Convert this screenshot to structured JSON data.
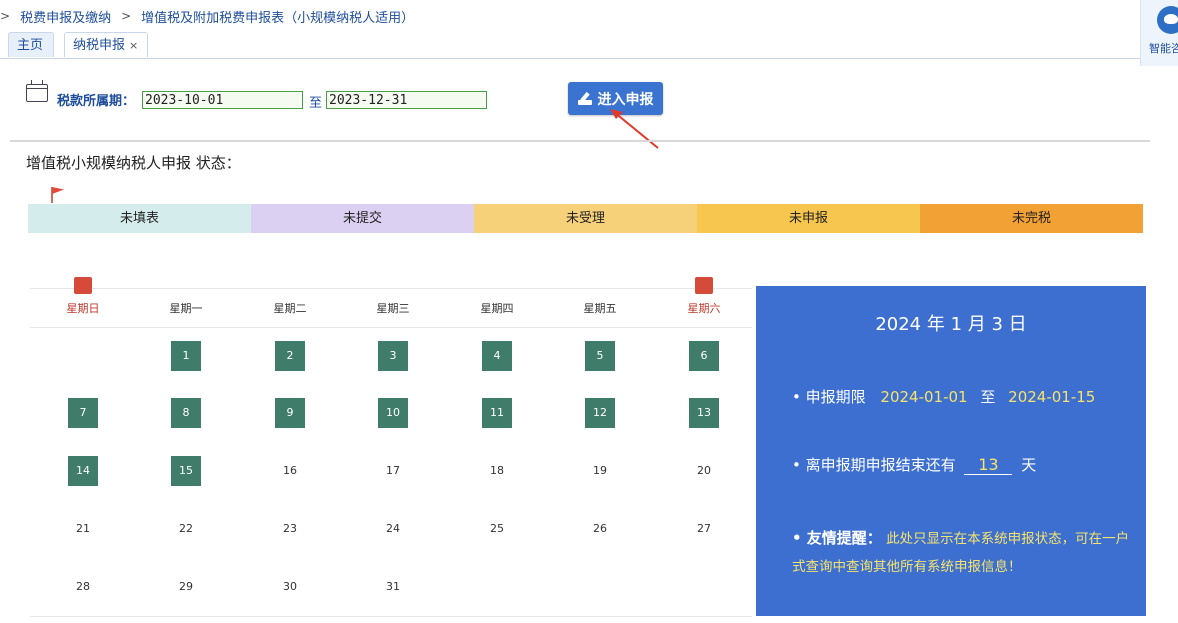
{
  "breadcrumb": {
    "items": [
      "税费申报及缴纳",
      "增值税及附加税费申报表（小规模纳税人适用）"
    ]
  },
  "tabs": [
    {
      "label": "主页"
    },
    {
      "label": "纳税申报",
      "close": "×"
    }
  ],
  "assistant": {
    "label": "智能咨"
  },
  "period": {
    "label": "税款所属期：",
    "start": "2023-10-01",
    "to": "至",
    "end": "2023-12-31"
  },
  "enter_button": {
    "label": "进入申报"
  },
  "status": {
    "title": "增值税小规模纳税人申报 状态：",
    "legend": [
      {
        "label": "未填表",
        "color": "#d5ecec"
      },
      {
        "label": "未提交",
        "color": "#dcd0f2"
      },
      {
        "label": "未受理",
        "color": "#f7d07a"
      },
      {
        "label": "未申报",
        "color": "#f7c64e"
      },
      {
        "label": "未完税",
        "color": "#f2a135"
      }
    ]
  },
  "calendar": {
    "weekdays": [
      "星期日",
      "星期一",
      "星期二",
      "星期三",
      "星期四",
      "星期五",
      "星期六"
    ],
    "weeks": [
      [
        "",
        "1",
        "2",
        "3",
        "4",
        "5",
        "6"
      ],
      [
        "7",
        "8",
        "9",
        "10",
        "11",
        "12",
        "13"
      ],
      [
        "14",
        "15",
        "16",
        "17",
        "18",
        "19",
        "20"
      ],
      [
        "21",
        "22",
        "23",
        "24",
        "25",
        "26",
        "27"
      ],
      [
        "28",
        "29",
        "30",
        "31",
        "",
        "",
        ""
      ]
    ],
    "filled_days": [
      "1",
      "2",
      "3",
      "4",
      "5",
      "6",
      "7",
      "8",
      "9",
      "10",
      "11",
      "12",
      "13",
      "14",
      "15"
    ]
  },
  "info": {
    "date": "2024 年 1 月 3 日",
    "deadline_label": "• 申报期限",
    "deadline_start": "2024-01-01",
    "deadline_to": "至",
    "deadline_end": "2024-01-15",
    "remaining_label": "• 离申报期申报结束还有",
    "remaining_days": "13",
    "remaining_unit": "天",
    "tip_label": "• 友情提醒：",
    "tip_text": "此处只显示在本系统申报状态，可在一户式查询中查询其他所有系统申报信息！"
  }
}
